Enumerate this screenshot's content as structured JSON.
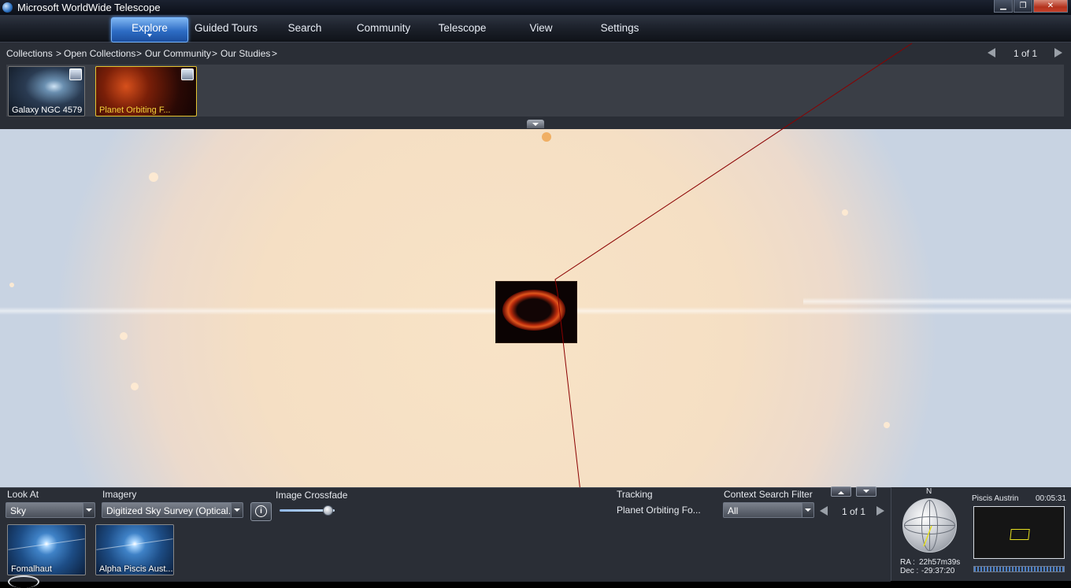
{
  "window": {
    "title": "Microsoft WorldWide Telescope",
    "controls": [
      "minimize",
      "maximize",
      "close"
    ]
  },
  "menu": {
    "items": [
      {
        "label": "Explore",
        "active": true
      },
      {
        "label": "Guided Tours",
        "active": false
      },
      {
        "label": "Search",
        "active": false
      },
      {
        "label": "Community",
        "active": false
      },
      {
        "label": "Telescope",
        "active": false
      },
      {
        "label": "View",
        "active": false
      },
      {
        "label": "Settings",
        "active": false
      }
    ]
  },
  "breadcrumb": {
    "items": [
      "Collections",
      "Open Collections",
      "Our Community",
      "Our Studies"
    ],
    "separator": ">",
    "page_indicator": "1 of 1"
  },
  "collection_thumbnails": [
    {
      "label": "Galaxy NGC 4579",
      "selected": false,
      "icon": "image-icon"
    },
    {
      "label": "Planet Orbiting F...",
      "selected": true,
      "icon": "image-icon"
    }
  ],
  "viewer": {
    "image_label": "Planet Orbiting Fomalhaut",
    "line_color": "#8b0000"
  },
  "bottom": {
    "look_at": {
      "label": "Look At",
      "value": "Sky"
    },
    "imagery": {
      "label": "Imagery",
      "value": "Digitized Sky Survey (Optical..."
    },
    "crossfade": {
      "label": "Image Crossfade",
      "level": 0.85
    },
    "tracking": {
      "label": "Tracking",
      "value": "Planet Orbiting Fo..."
    },
    "context_filter": {
      "label": "Context Search Filter",
      "value": "All",
      "page_indicator": "1 of 1"
    },
    "context_results": [
      {
        "label": "Fomalhaut"
      },
      {
        "label": "Alpha Piscis Aust..."
      }
    ]
  },
  "nav_panel": {
    "north_label": "N",
    "ra_label": "RA :",
    "ra_value": "22h57m39s",
    "dec_label": "Dec :",
    "dec_value": "-29:37:20",
    "constellation": "Piscis Austrin",
    "time": "00:05:31"
  },
  "colors": {
    "accent_blue": "#2d6cc4",
    "panel_bg": "#2a2e36",
    "selected_text": "#f3d13a"
  }
}
